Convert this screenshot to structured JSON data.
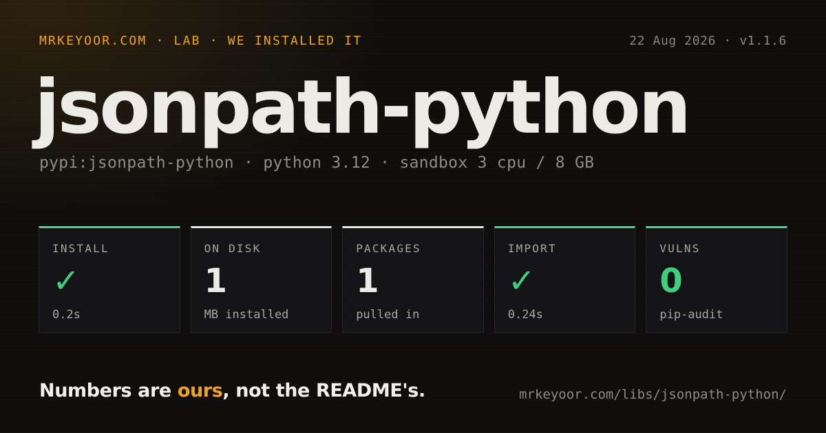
{
  "header": {
    "breadcrumb": "MRKEYOOR.COM · LAB · WE INSTALLED IT",
    "meta": "22 Aug 2026 · v1.1.6"
  },
  "package": {
    "name": "jsonpath-python",
    "details": "pypi:jsonpath-python · python 3.12 · sandbox 3 cpu / 8 GB"
  },
  "stats": [
    {
      "label": "INSTALL",
      "value": "✓",
      "note": "0.2s",
      "accent": "#4cd38c"
    },
    {
      "label": "ON DISK",
      "value": "1",
      "note": "MB installed",
      "accent": "#e6e4df"
    },
    {
      "label": "PACKAGES",
      "value": "1",
      "note": "pulled in",
      "accent": "#e6e4df"
    },
    {
      "label": "IMPORT",
      "value": "✓",
      "note": "0.24s",
      "accent": "#4cd38c"
    },
    {
      "label": "VULNS",
      "value": "0",
      "note": "pip-audit",
      "accent": "#4cd38c"
    }
  ],
  "footer": {
    "tagline_start": "Numbers are ",
    "tagline_accent": "ours",
    "tagline_end": ", not the README's.",
    "url": "mrkeyoor.com/libs/jsonpath-python/"
  },
  "colors": {
    "background": "#0f0e0d",
    "accent_orange": "#f0a41e",
    "success_green": "#3fd07f",
    "text_primary": "#ecebe6",
    "text_muted": "#8f8c85"
  }
}
